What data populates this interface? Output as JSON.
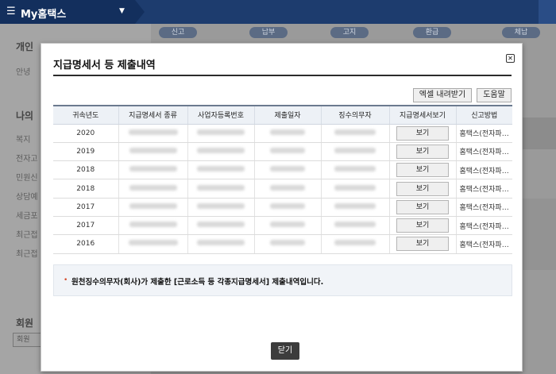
{
  "topbar": {
    "menu_icon": "☰",
    "app_title": "My홈택스",
    "caret": "▼"
  },
  "background": {
    "tabs": [
      "신고",
      "납부",
      "고지",
      "환급",
      "체납"
    ],
    "sidebar_headings": [
      "개인",
      "나의",
      "회원"
    ],
    "sidebar_items": [
      "안녕",
      "복지",
      "전자고",
      "민원신",
      "상담예",
      "세금포",
      "최근접",
      "최근접"
    ],
    "bottom_field": "회원"
  },
  "modal": {
    "title": "지급명세서 등 제출내역",
    "close_icon": "✕",
    "excel_button": "엑셀 내려받기",
    "help_button": "도움말",
    "table": {
      "headers": [
        "귀속년도",
        "지급명세서 종류",
        "사업자등록번호",
        "제출일자",
        "징수의무자",
        "지급명세서보기",
        "신고방법"
      ],
      "rows": [
        {
          "year": "2020",
          "view": "보기",
          "method": "홈택스(전자파…"
        },
        {
          "year": "2019",
          "view": "보기",
          "method": "홈택스(전자파…"
        },
        {
          "year": "2018",
          "view": "보기",
          "method": "홈택스(전자파…"
        },
        {
          "year": "2018",
          "view": "보기",
          "method": "홈택스(전자파…"
        },
        {
          "year": "2017",
          "view": "보기",
          "method": "홈택스(전자파…"
        },
        {
          "year": "2017",
          "view": "보기",
          "method": "홈택스(전자파…"
        },
        {
          "year": "2016",
          "view": "보기",
          "method": "홈택스(전자파…"
        }
      ]
    },
    "notice_bullet": "•",
    "notice": "원천징수의무자(회사)가 제출한 [근로소득 등 각종지급명세서] 제출내역입니다.",
    "close_button": "닫기"
  }
}
